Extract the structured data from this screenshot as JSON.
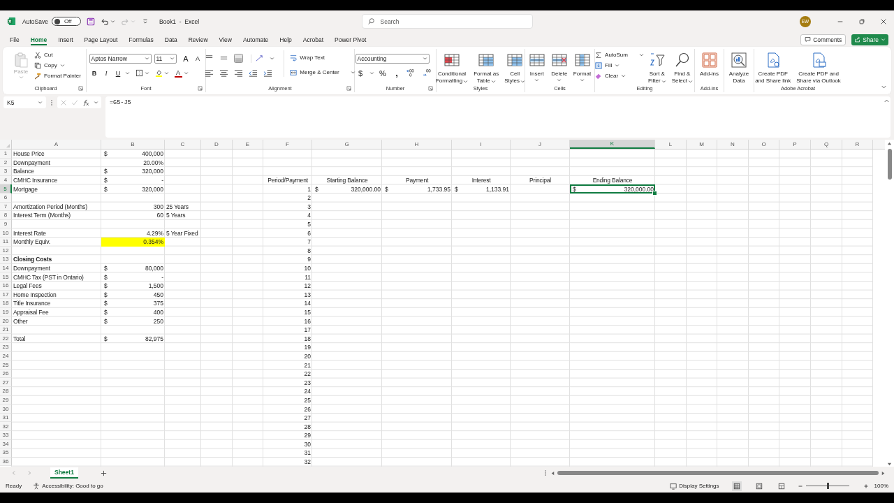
{
  "title_bar": {
    "autosave": {
      "label": "AutoSave",
      "state": "Off",
      "on": false
    },
    "title": "Book1  -  Excel",
    "search": {
      "placeholder": "Search"
    },
    "avatar": "EW"
  },
  "ribbon_tabs": [
    {
      "label": "File",
      "selected": false
    },
    {
      "label": "Home",
      "selected": true
    },
    {
      "label": "Insert",
      "selected": false
    },
    {
      "label": "Page Layout",
      "selected": false
    },
    {
      "label": "Formulas",
      "selected": false
    },
    {
      "label": "Data",
      "selected": false
    },
    {
      "label": "Review",
      "selected": false
    },
    {
      "label": "View",
      "selected": false
    },
    {
      "label": "Automate",
      "selected": false
    },
    {
      "label": "Help",
      "selected": false
    },
    {
      "label": "Acrobat",
      "selected": false
    },
    {
      "label": "Power Pivot",
      "selected": false
    }
  ],
  "ribbon_actions": {
    "comments": "Comments",
    "share": "Share"
  },
  "ribbon": {
    "groups": [
      {
        "kind": "clipboard",
        "label": "Clipboard",
        "paste": {
          "label": "Paste",
          "disabled": true
        },
        "items": [
          "Cut",
          "Copy",
          "Format Painter"
        ]
      },
      {
        "kind": "font",
        "label": "Font",
        "font_name": "Aptos Narrow",
        "font_size": "11",
        "grow": "A",
        "shrink": "A",
        "bold": "B",
        "italic": "I",
        "underline": "U",
        "font_color": "A"
      },
      {
        "kind": "alignment",
        "label": "Alignment",
        "vertical_align": [
          {
            "selected": false
          },
          {
            "selected": false
          },
          {
            "selected": true
          }
        ],
        "wrap": "Wrap Text",
        "merge": "Merge & Center"
      },
      {
        "kind": "number",
        "label": "Number",
        "format": "Accounting",
        "currency": "$",
        "percent": "%",
        "comma": ","
      },
      {
        "kind": "buttons",
        "label": "Styles",
        "buttons": [
          {
            "lines": [
              "Conditional",
              "Formatting"
            ],
            "menu": true
          },
          {
            "lines": [
              "Format as",
              "Table"
            ],
            "menu": true
          },
          {
            "lines": [
              "Cell",
              "Styles"
            ],
            "menu": true
          }
        ]
      },
      {
        "kind": "buttons",
        "label": "Cells",
        "buttons": [
          {
            "lines": [
              "Insert"
            ],
            "menu": true
          },
          {
            "lines": [
              "Delete"
            ],
            "menu": true
          },
          {
            "lines": [
              "Format"
            ],
            "menu": true
          }
        ]
      },
      {
        "kind": "editing",
        "label": "Editing",
        "items": [
          {
            "label": "AutoSum"
          },
          {
            "label": "Fill"
          },
          {
            "label": "Clear"
          }
        ],
        "buttons": [
          {
            "lines": [
              "Sort &",
              "Filter"
            ],
            "menu": true
          },
          {
            "lines": [
              "Find &",
              "Select"
            ],
            "menu": true
          }
        ]
      },
      {
        "kind": "buttons",
        "label": "Add-ins",
        "buttons": [
          {
            "lines": [
              "Add-ins"
            ],
            "menu": false
          }
        ]
      },
      {
        "kind": "buttons",
        "buttons": [
          {
            "lines": [
              "Analyze",
              "Data"
            ],
            "menu": false
          }
        ]
      },
      {
        "kind": "buttons",
        "label": "Adobe Acrobat",
        "buttons": [
          {
            "lines": [
              "Create PDF",
              "and Share link"
            ],
            "menu": false
          },
          {
            "lines": [
              "Create PDF and",
              "Share via Outlook"
            ],
            "menu": false
          }
        ]
      }
    ]
  },
  "formula_bar": {
    "name_box": "K5",
    "formula": "=G5-J5"
  },
  "sheet": {
    "columns": [
      {
        "label": "A",
        "selected": false
      },
      {
        "label": "B",
        "selected": false
      },
      {
        "label": "C",
        "selected": false
      },
      {
        "label": "D",
        "selected": false
      },
      {
        "label": "E",
        "selected": false
      },
      {
        "label": "F",
        "selected": false
      },
      {
        "label": "G",
        "selected": false
      },
      {
        "label": "H",
        "selected": false
      },
      {
        "label": "I",
        "selected": false
      },
      {
        "label": "J",
        "selected": false
      },
      {
        "label": "K",
        "selected": true
      },
      {
        "label": "L",
        "selected": false
      },
      {
        "label": "M",
        "selected": false
      },
      {
        "label": "N",
        "selected": false
      },
      {
        "label": "O",
        "selected": false
      },
      {
        "label": "P",
        "selected": false
      },
      {
        "label": "Q",
        "selected": false
      },
      {
        "label": "R",
        "selected": false
      }
    ],
    "rows": [
      {
        "number": "1",
        "selected": false,
        "cells": [
          {
            "kind": "text",
            "value": "House Price"
          },
          {
            "kind": "accounting",
            "currency": "$",
            "value": "400,000"
          }
        ]
      },
      {
        "number": "2",
        "selected": false,
        "cells": [
          {
            "kind": "text",
            "value": "Downpayment"
          },
          {
            "kind": "number",
            "value": "20.00%"
          }
        ]
      },
      {
        "number": "3",
        "selected": false,
        "cells": [
          {
            "kind": "text",
            "value": "Balance"
          },
          {
            "kind": "accounting",
            "currency": "$",
            "value": "320,000"
          }
        ]
      },
      {
        "number": "4",
        "selected": false,
        "cells": [
          {
            "kind": "text",
            "value": "CMHC Insurance"
          },
          {
            "kind": "accounting",
            "currency": "$",
            "value": "-"
          },
          "",
          "",
          "",
          {
            "kind": "heading",
            "value": "Period/Payment"
          },
          {
            "kind": "heading",
            "value": "Starting Balance"
          },
          {
            "kind": "heading",
            "value": "Payment"
          },
          {
            "kind": "heading",
            "value": "Interest"
          },
          {
            "kind": "heading",
            "value": "Principal"
          },
          {
            "kind": "heading",
            "value": "Ending Balance"
          }
        ]
      },
      {
        "number": "5",
        "selected": true,
        "cells": [
          {
            "kind": "text",
            "value": "Mortgage"
          },
          {
            "kind": "accounting",
            "currency": "$",
            "value": "320,000"
          },
          "",
          "",
          "",
          {
            "kind": "number",
            "value": "1"
          },
          {
            "kind": "accounting",
            "currency": "$",
            "value": "320,000.00"
          },
          {
            "kind": "accounting",
            "currency": "$",
            "value": "1,733.95"
          },
          {
            "kind": "accounting",
            "currency": "$",
            "value": "1,133.91"
          },
          "",
          {
            "kind": "accounting",
            "currency": "$",
            "value": "320,000.00"
          }
        ]
      },
      {
        "number": "6",
        "selected": false,
        "cells": [
          "",
          "",
          "",
          "",
          "",
          {
            "kind": "number",
            "value": "2"
          }
        ]
      },
      {
        "number": "7",
        "selected": false,
        "cells": [
          {
            "kind": "text",
            "value": "Amortization Period (Months)"
          },
          {
            "kind": "number",
            "value": "300"
          },
          {
            "kind": "text",
            "value": "25 Years"
          },
          "",
          "",
          {
            "kind": "number",
            "value": "3"
          }
        ]
      },
      {
        "number": "8",
        "selected": false,
        "cells": [
          {
            "kind": "text",
            "value": "Interest Term (Months)"
          },
          {
            "kind": "number",
            "value": "60"
          },
          {
            "kind": "text",
            "value": "5 Years"
          },
          "",
          "",
          {
            "kind": "number",
            "value": "4"
          }
        ]
      },
      {
        "number": "9",
        "selected": false,
        "cells": [
          "",
          "",
          "",
          "",
          "",
          {
            "kind": "number",
            "value": "5"
          }
        ]
      },
      {
        "number": "10",
        "selected": false,
        "cells": [
          {
            "kind": "text",
            "value": "Interest Rate"
          },
          {
            "kind": "number",
            "value": "4.29%"
          },
          {
            "kind": "text",
            "value": "5 Year Fixed"
          },
          "",
          "",
          {
            "kind": "number",
            "value": "6"
          }
        ]
      },
      {
        "number": "11",
        "selected": false,
        "cells": [
          {
            "kind": "text",
            "value": "Monthly Equiv."
          },
          {
            "kind": "number",
            "value": "0.354%",
            "color": "#ffff00"
          },
          "",
          "",
          "",
          {
            "kind": "number",
            "value": "7"
          }
        ]
      },
      {
        "number": "12",
        "selected": false,
        "cells": [
          "",
          "",
          "",
          "",
          "",
          {
            "kind": "number",
            "value": "8"
          }
        ]
      },
      {
        "number": "13",
        "selected": false,
        "cells": [
          {
            "kind": "title",
            "value": "Closing Costs"
          },
          "",
          "",
          "",
          "",
          {
            "kind": "number",
            "value": "9"
          }
        ]
      },
      {
        "number": "14",
        "selected": false,
        "cells": [
          {
            "kind": "text",
            "value": "Downpayment"
          },
          {
            "kind": "accounting",
            "currency": "$",
            "value": "80,000"
          },
          "",
          "",
          "",
          {
            "kind": "number",
            "value": "10"
          }
        ]
      },
      {
        "number": "15",
        "selected": false,
        "cells": [
          {
            "kind": "text",
            "value": "CMHC Tax (PST in Ontario)"
          },
          {
            "kind": "accounting",
            "currency": "$",
            "value": "-"
          },
          "",
          "",
          "",
          {
            "kind": "number",
            "value": "11"
          }
        ]
      },
      {
        "number": "16",
        "selected": false,
        "cells": [
          {
            "kind": "text",
            "value": "Legal Fees"
          },
          {
            "kind": "accounting",
            "currency": "$",
            "value": "1,500"
          },
          "",
          "",
          "",
          {
            "kind": "number",
            "value": "12"
          }
        ]
      },
      {
        "number": "17",
        "selected": false,
        "cells": [
          {
            "kind": "text",
            "value": "Home Inspection"
          },
          {
            "kind": "accounting",
            "currency": "$",
            "value": "450"
          },
          "",
          "",
          "",
          {
            "kind": "number",
            "value": "13"
          }
        ]
      },
      {
        "number": "18",
        "selected": false,
        "cells": [
          {
            "kind": "text",
            "value": "Title Insurance"
          },
          {
            "kind": "accounting",
            "currency": "$",
            "value": "375"
          },
          "",
          "",
          "",
          {
            "kind": "number",
            "value": "14"
          }
        ]
      },
      {
        "number": "19",
        "selected": false,
        "cells": [
          {
            "kind": "text",
            "value": "Appraisal Fee"
          },
          {
            "kind": "accounting",
            "currency": "$",
            "value": "400"
          },
          "",
          "",
          "",
          {
            "kind": "number",
            "value": "15"
          }
        ]
      },
      {
        "number": "20",
        "selected": false,
        "cells": [
          {
            "kind": "text",
            "value": "Other"
          },
          {
            "kind": "accounting",
            "currency": "$",
            "value": "250"
          },
          "",
          "",
          "",
          {
            "kind": "number",
            "value": "16"
          }
        ]
      },
      {
        "number": "21",
        "selected": false,
        "cells": [
          "",
          "",
          "",
          "",
          "",
          {
            "kind": "number",
            "value": "17"
          }
        ]
      },
      {
        "number": "22",
        "selected": false,
        "cells": [
          {
            "kind": "text",
            "value": "Total"
          },
          {
            "kind": "accounting",
            "currency": "$",
            "value": "82,975"
          },
          "",
          "",
          "",
          {
            "kind": "number",
            "value": "18"
          }
        ]
      },
      {
        "number": "23",
        "selected": false,
        "cells": [
          "",
          "",
          "",
          "",
          "",
          {
            "kind": "number",
            "value": "19"
          }
        ]
      },
      {
        "number": "24",
        "selected": false,
        "cells": [
          "",
          "",
          "",
          "",
          "",
          {
            "kind": "number",
            "value": "20"
          }
        ]
      },
      {
        "number": "25",
        "selected": false,
        "cells": [
          "",
          "",
          "",
          "",
          "",
          {
            "kind": "number",
            "value": "21"
          }
        ]
      },
      {
        "number": "26",
        "selected": false,
        "cells": [
          "",
          "",
          "",
          "",
          "",
          {
            "kind": "number",
            "value": "22"
          }
        ]
      },
      {
        "number": "27",
        "selected": false,
        "cells": [
          "",
          "",
          "",
          "",
          "",
          {
            "kind": "number",
            "value": "23"
          }
        ]
      },
      {
        "number": "28",
        "selected": false,
        "cells": [
          "",
          "",
          "",
          "",
          "",
          {
            "kind": "number",
            "value": "24"
          }
        ]
      },
      {
        "number": "29",
        "selected": false,
        "cells": [
          "",
          "",
          "",
          "",
          "",
          {
            "kind": "number",
            "value": "25"
          }
        ]
      },
      {
        "number": "30",
        "selected": false,
        "cells": [
          "",
          "",
          "",
          "",
          "",
          {
            "kind": "number",
            "value": "26"
          }
        ]
      },
      {
        "number": "31",
        "selected": false,
        "cells": [
          "",
          "",
          "",
          "",
          "",
          {
            "kind": "number",
            "value": "27"
          }
        ]
      },
      {
        "number": "32",
        "selected": false,
        "cells": [
          "",
          "",
          "",
          "",
          "",
          {
            "kind": "number",
            "value": "28"
          }
        ]
      },
      {
        "number": "33",
        "selected": false,
        "cells": [
          "",
          "",
          "",
          "",
          "",
          {
            "kind": "number",
            "value": "29"
          }
        ]
      },
      {
        "number": "34",
        "selected": false,
        "cells": [
          "",
          "",
          "",
          "",
          "",
          {
            "kind": "number",
            "value": "30"
          }
        ]
      },
      {
        "number": "35",
        "selected": false,
        "cells": [
          "",
          "",
          "",
          "",
          "",
          {
            "kind": "number",
            "value": "31"
          }
        ]
      },
      {
        "number": "36",
        "selected": false,
        "cells": [
          "",
          "",
          "",
          "",
          "",
          {
            "kind": "number",
            "value": "32"
          }
        ]
      }
    ]
  },
  "sheet_tabs": [
    {
      "label": "Sheet1",
      "selected": true
    }
  ],
  "status_bar": {
    "mode": "Ready",
    "accessibility": "Accessibility: Good to go",
    "display_settings": "Display Settings",
    "zoom": {
      "level": 0.5
    },
    "zoom_reading": "100%"
  }
}
